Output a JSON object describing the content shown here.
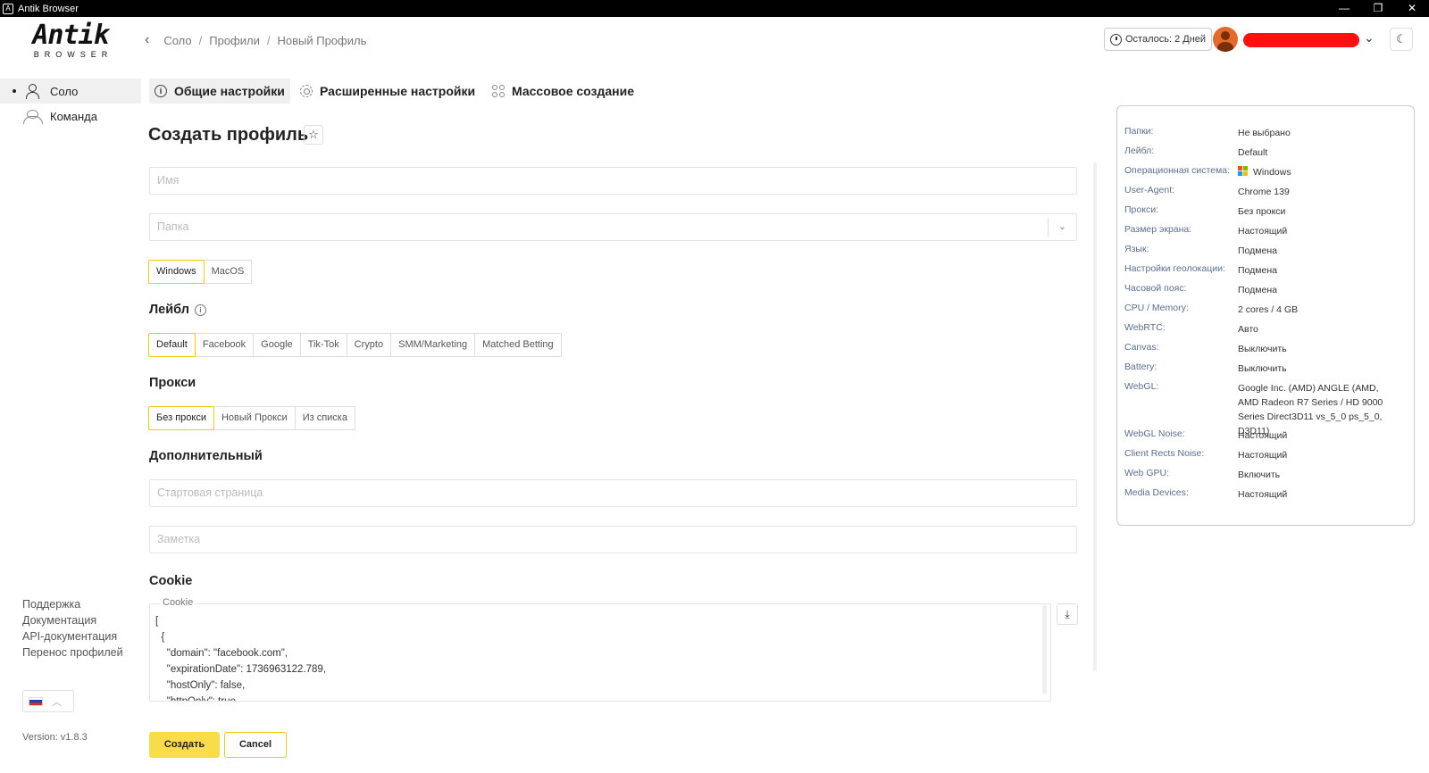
{
  "window": {
    "title": "Antik Browser",
    "minimize": "—",
    "restore": "❐",
    "close": "✕"
  },
  "logo": {
    "main": "Antik",
    "sub": "BROWSER"
  },
  "breadcrumb": {
    "items": [
      "Соло",
      "Профили",
      "Новый Профиль"
    ],
    "separator": "/"
  },
  "header": {
    "trial_text": "Осталось: 2 Дней",
    "brand_color": "#f9dc4a"
  },
  "sidebar": {
    "items": [
      {
        "label": "Соло",
        "icon": "person-icon",
        "active": true
      },
      {
        "label": "Команда",
        "icon": "team-icon",
        "active": false
      }
    ],
    "links": [
      "Поддержка",
      "Документация",
      "API-документация",
      "Перенос профилей"
    ],
    "language": "ru",
    "version": "Version: v1.8.3"
  },
  "tabs": [
    {
      "label": "Общие настройки",
      "icon": "info-icon",
      "active": true
    },
    {
      "label": "Расширенные настройки",
      "icon": "gear-icon",
      "active": false
    },
    {
      "label": "Массовое создание",
      "icon": "grid-icon",
      "active": false
    }
  ],
  "form": {
    "title": "Создать профиль",
    "name_placeholder": "Имя",
    "folder_placeholder": "Папка",
    "os_options": [
      "Windows",
      "MacOS"
    ],
    "os_selected": "Windows",
    "label_title": "Лейбл",
    "labels": [
      "Default",
      "Facebook",
      "Google",
      "Tik-Tok",
      "Crypto",
      "SMM/Marketing",
      "Matched Betting"
    ],
    "label_selected": "Default",
    "proxy_title": "Прокси",
    "proxy_options": [
      "Без прокси",
      "Новый Прокси",
      "Из списка"
    ],
    "proxy_selected": "Без прокси",
    "additional_title": "Дополнительный",
    "start_page_placeholder": "Стартовая страница",
    "note_placeholder": "Заметка",
    "cookie_title": "Cookie",
    "cookie_legend": "Cookie",
    "cookie_value": "[\n  {\n    \"domain\": \"facebook.com\",\n    \"expirationDate\": 1736963122.789,\n    \"hostOnly\": false,\n    \"httpOnly\": true,",
    "create_label": "Создать",
    "cancel_label": "Cancel"
  },
  "summary": [
    {
      "key": "Папки:",
      "value": "Не выбрано"
    },
    {
      "key": "Лейбл:",
      "value": "Default"
    },
    {
      "key": "Операционная система:",
      "value": "Windows"
    },
    {
      "key": "User-Agent:",
      "value": "Chrome 139"
    },
    {
      "key": "Прокси:",
      "value": "Без прокси"
    },
    {
      "key": "Размер экрана:",
      "value": "Настоящий"
    },
    {
      "key": "Язык:",
      "value": "Подмена"
    },
    {
      "key": "Настройки геолокации:",
      "value": "Подмена"
    },
    {
      "key": "Часовой пояс:",
      "value": "Подмена"
    },
    {
      "key": "CPU / Memory:",
      "value": "2 cores / 4 GB"
    },
    {
      "key": "WebRTC:",
      "value": "Авто"
    },
    {
      "key": "Canvas:",
      "value": "Выключить"
    },
    {
      "key": "Battery:",
      "value": "Выключить"
    },
    {
      "key": "WebGL:",
      "value": "Google Inc. (AMD) ANGLE (AMD, AMD Radeon R7 Series / HD 9000 Series Direct3D11 vs_5_0 ps_5_0, D3D11)"
    },
    {
      "key": "WebGL Noise:",
      "value": "Настоящий"
    },
    {
      "key": "Client Rects Noise:",
      "value": "Настоящий"
    },
    {
      "key": "Web GPU:",
      "value": "Включить"
    },
    {
      "key": "Media Devices:",
      "value": "Настоящий"
    }
  ]
}
